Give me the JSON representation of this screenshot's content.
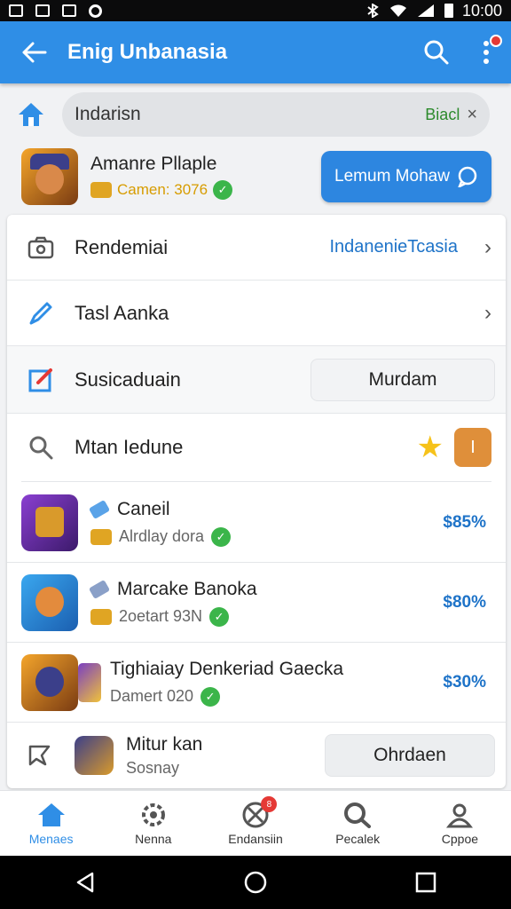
{
  "status_bar": {
    "time": "10:00"
  },
  "app_bar": {
    "title": "Enig Unbanasia"
  },
  "search": {
    "value": "Indarisn",
    "tag": "Biacl",
    "clear": "×"
  },
  "profile": {
    "name": "Amanre Pllaple",
    "subtitle": "Camen: 3076",
    "check": "✓",
    "cta_label": "Lemum Mohaw"
  },
  "rows": [
    {
      "label": "Rendemiai",
      "value": "IndanenieTcasia",
      "chevron": "›"
    },
    {
      "label": "Tasl Aanka",
      "chevron": "›"
    },
    {
      "label": "Susicaduain",
      "select": "Murdam"
    },
    {
      "label": "Mtan Iedune",
      "star": "★",
      "badge": "I"
    }
  ],
  "games": [
    {
      "title": "Caneil",
      "subtitle": "Alrdlay dora",
      "percent": "$85%",
      "check": "✓"
    },
    {
      "title": "Marcake Banoka",
      "subtitle": "2oetart 93N",
      "percent": "$80%",
      "check": "✓"
    },
    {
      "title": "Tighiaiay Denkeriad Gaecka",
      "subtitle": "Damert 020",
      "percent": "$30%",
      "check": "✓"
    }
  ],
  "last_row": {
    "title": "Mitur kan",
    "subtitle": "Sosnay",
    "button": "Ohrdaen"
  },
  "bottom_nav": [
    {
      "label": "Menaes"
    },
    {
      "label": "Nenna"
    },
    {
      "label": "Endansiin",
      "badge": "8"
    },
    {
      "label": "Pecalek"
    },
    {
      "label": "Cppoe"
    }
  ],
  "colors": {
    "primary": "#2f8ee6",
    "accent_green": "#3bb54a",
    "link_blue": "#1e73c8",
    "badge_red": "#e53935"
  }
}
